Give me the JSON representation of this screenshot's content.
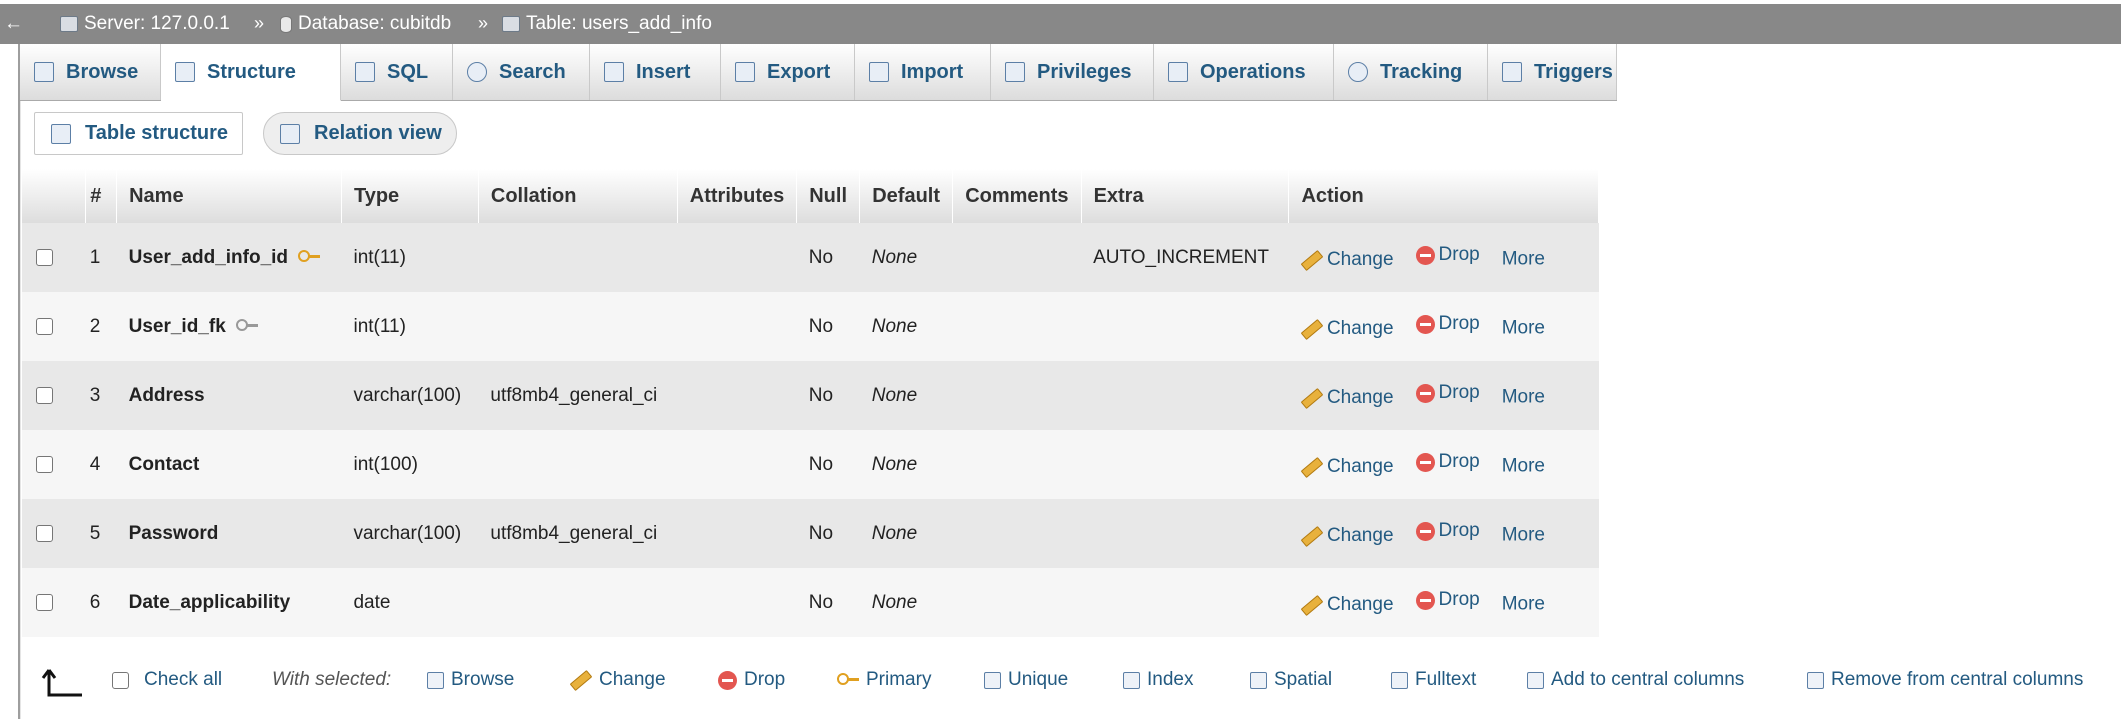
{
  "breadcrumb": {
    "back_glyph": "←",
    "server": "Server: 127.0.0.1",
    "sep1": "»",
    "database": "Database: cubitdb",
    "sep2": "»",
    "table": "Table: users_add_info"
  },
  "tabs": [
    {
      "label": "Browse",
      "icon": "browse-icon"
    },
    {
      "label": "Structure",
      "icon": "structure-icon",
      "active": true
    },
    {
      "label": "SQL",
      "icon": "sql-icon"
    },
    {
      "label": "Search",
      "icon": "search-icon"
    },
    {
      "label": "Insert",
      "icon": "insert-icon"
    },
    {
      "label": "Export",
      "icon": "export-icon"
    },
    {
      "label": "Import",
      "icon": "import-icon"
    },
    {
      "label": "Privileges",
      "icon": "privileges-icon"
    },
    {
      "label": "Operations",
      "icon": "wrench-icon"
    },
    {
      "label": "Tracking",
      "icon": "eye-icon"
    },
    {
      "label": "Triggers",
      "icon": "triggers-icon"
    }
  ],
  "subtabs": {
    "table_structure": "Table structure",
    "relation_view": "Relation view"
  },
  "table": {
    "headers": {
      "num": "#",
      "name": "Name",
      "type": "Type",
      "collation": "Collation",
      "attributes": "Attributes",
      "null": "Null",
      "default": "Default",
      "comments": "Comments",
      "extra": "Extra",
      "action": "Action"
    },
    "rows": [
      {
        "num": "1",
        "name": "User_add_info_id",
        "key": "primary",
        "type": "int(11)",
        "collation": "",
        "attributes": "",
        "null": "No",
        "default": "None",
        "comments": "",
        "extra": "AUTO_INCREMENT"
      },
      {
        "num": "2",
        "name": "User_id_fk",
        "key": "foreign",
        "type": "int(11)",
        "collation": "",
        "attributes": "",
        "null": "No",
        "default": "None",
        "comments": "",
        "extra": ""
      },
      {
        "num": "3",
        "name": "Address",
        "key": "",
        "type": "varchar(100)",
        "collation": "utf8mb4_general_ci",
        "attributes": "",
        "null": "No",
        "default": "None",
        "comments": "",
        "extra": ""
      },
      {
        "num": "4",
        "name": "Contact",
        "key": "",
        "type": "int(100)",
        "collation": "",
        "attributes": "",
        "null": "No",
        "default": "None",
        "comments": "",
        "extra": ""
      },
      {
        "num": "5",
        "name": "Password",
        "key": "",
        "type": "varchar(100)",
        "collation": "utf8mb4_general_ci",
        "attributes": "",
        "null": "No",
        "default": "None",
        "comments": "",
        "extra": ""
      },
      {
        "num": "6",
        "name": "Date_applicability",
        "key": "",
        "type": "date",
        "collation": "",
        "attributes": "",
        "null": "No",
        "default": "None",
        "comments": "",
        "extra": ""
      }
    ],
    "actions": {
      "change": "Change",
      "drop": "Drop",
      "more": "More"
    }
  },
  "footer": {
    "check_all": "Check all",
    "with_selected": "With selected:",
    "browse": "Browse",
    "change": "Change",
    "drop": "Drop",
    "primary": "Primary",
    "unique": "Unique",
    "index": "Index",
    "spatial": "Spatial",
    "fulltext": "Fulltext",
    "add_central": "Add to central columns",
    "remove_central": "Remove from central columns"
  },
  "colors": {
    "link": "#235a81",
    "header_bar": "#888888",
    "drop_red": "#e35650",
    "primary_key": "#e0a020"
  }
}
